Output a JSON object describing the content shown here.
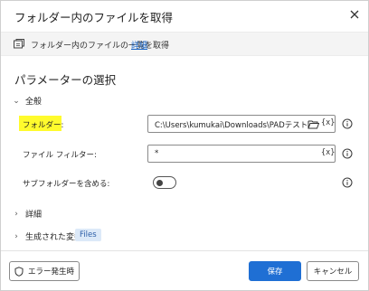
{
  "dialog": {
    "title": "フォルダー内のファイルを取得",
    "close_icon": "close-icon"
  },
  "info": {
    "icon": "folder-files-icon",
    "text": "フォルダー内のファイルの一覧を取得",
    "link": "詳細"
  },
  "params": {
    "heading": "パラメーターの選択",
    "general_section": "全般",
    "folder": {
      "label": "フォルダー:",
      "value": "C:\\Users\\kumukai\\Downloads\\PADテスト",
      "var_button": "{x}",
      "browse_icon": "folder-open-icon"
    },
    "file_filter": {
      "label": "ファイル フィルター:",
      "value": "*",
      "var_button": "{x}"
    },
    "include_subfolders": {
      "label": "サブフォルダーを含める:",
      "checked": false
    },
    "details_section": "詳細",
    "generated_vars_section": "生成された変数",
    "generated_vars_badge": "Files"
  },
  "footer": {
    "on_error": "エラー発生時",
    "save": "保存",
    "cancel": "キャンセル"
  },
  "colors": {
    "accent": "#1f6fd4",
    "highlight": "#fffb2d",
    "link": "#1462c7"
  }
}
